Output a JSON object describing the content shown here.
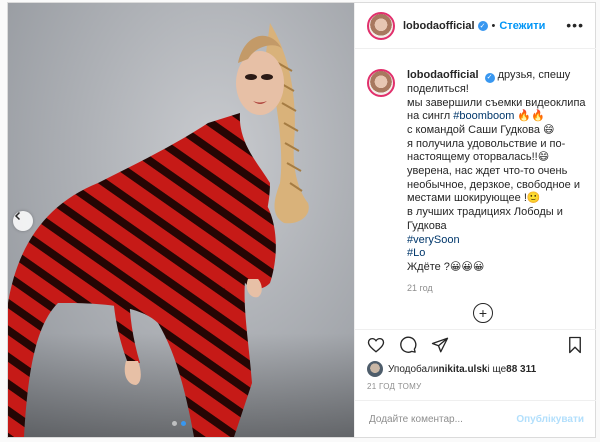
{
  "post": {
    "username": "lobodaofficial",
    "follow_label": "Стежити",
    "bullet": "•",
    "more_glyph": "•••",
    "verified_glyph": "✓"
  },
  "caption": {
    "username": "lobodaofficial",
    "lines": [
      {
        "text": "друзья, спешу поделиться!",
        "type": "text"
      },
      {
        "text": "мы завершили съемки видеоклипа на сингл ",
        "type": "text"
      },
      {
        "text": "#boomboom",
        "type": "tag"
      },
      {
        "text": " 🔥🔥",
        "type": "text"
      },
      {
        "text": "с командой Саши Гудкова 😄",
        "type": "text"
      },
      {
        "text": "я получила удовольствие и по-настоящему оторвалась!!😄",
        "type": "text"
      },
      {
        "text": "уверена, нас ждет что-то очень необычное, дерзкое, свободное и местами шокирующее !🙂",
        "type": "text"
      },
      {
        "text": "в лучших традициях Лободы и Гудкова",
        "type": "text"
      },
      {
        "text": "#verySoon",
        "type": "tag"
      },
      {
        "text": "#Lo",
        "type": "tag"
      },
      {
        "text": "Ждёте ?😀😀😀",
        "type": "text"
      }
    ],
    "time": "21 год"
  },
  "likes": {
    "prefix": "Уподобали ",
    "user": "nikita.ulsk",
    "suffix": " і ще ",
    "count": "88 311"
  },
  "date": "21 ГОД ТОМУ",
  "comment": {
    "placeholder": "Додайте коментар...",
    "publish_label": "Опублікувати"
  },
  "icons": {
    "like": "heart-icon",
    "comment": "comment-icon",
    "share": "send-icon",
    "save": "bookmark-icon",
    "load_more": "plus-circle-icon",
    "prev": "chevron-left-icon"
  },
  "carousel": {
    "total": 2,
    "active": 1
  },
  "colors": {
    "accent": "#0095f6",
    "verified": "#3897f0",
    "publish_disabled": "#b2dffc"
  }
}
